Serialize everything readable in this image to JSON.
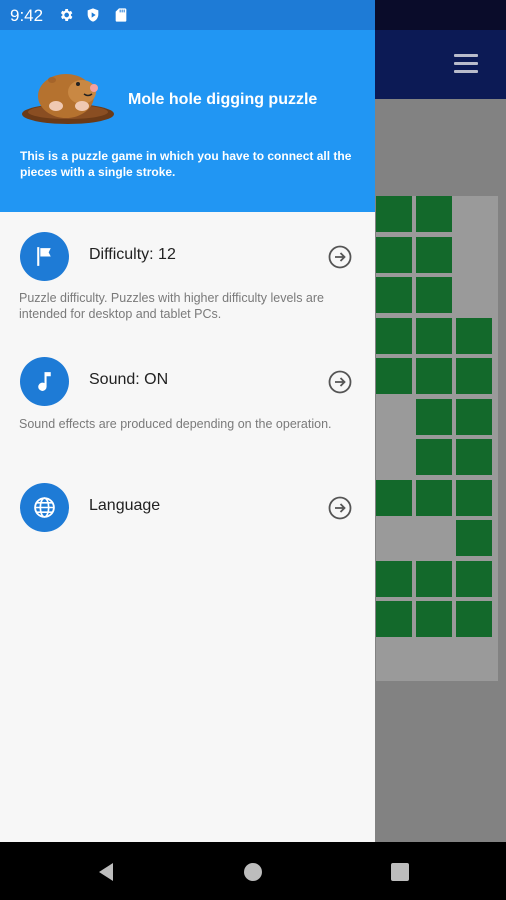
{
  "status_bar": {
    "time": "9:42"
  },
  "drawer": {
    "title": "Mole hole digging puzzle",
    "description": "This is a puzzle game in which you have to connect all the pieces with a single stroke.",
    "items": [
      {
        "label": "Difficulty: 12",
        "icon": "flag-icon",
        "help": "Puzzle difficulty. Puzzles with higher difficulty levels are intended for desktop and tablet PCs."
      },
      {
        "label": "Sound: ON",
        "icon": "music-note-icon",
        "help": "Sound effects are produced depending on the operation."
      },
      {
        "label": "Language",
        "icon": "globe-icon",
        "help": ""
      }
    ]
  },
  "colors": {
    "accent": "#2196f3",
    "icon_circle": "#1e7bd6",
    "board_cell": "#13692b"
  }
}
